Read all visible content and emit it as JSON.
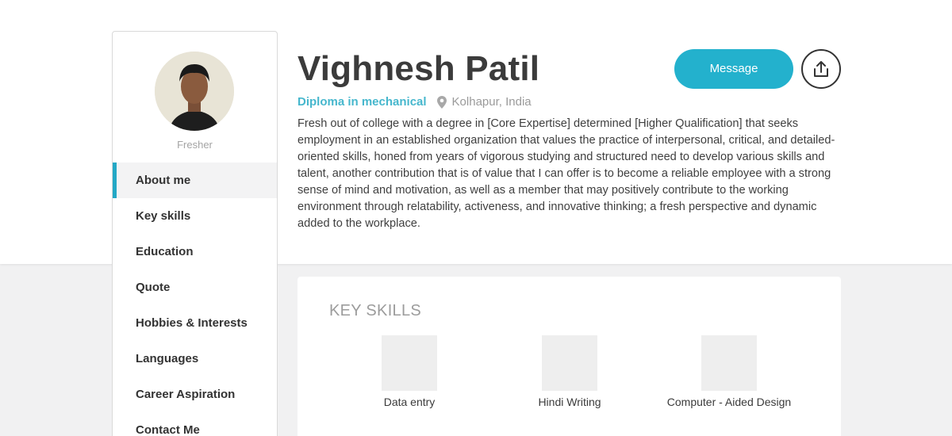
{
  "profile": {
    "name": "Vighnesh Patil",
    "qualification": "Diploma in mechanical",
    "location": "Kolhapur, India",
    "status": "Fresher",
    "bio": "Fresh out of college with a degree in [Core Expertise] determined [Higher Qualification] that seeks employment in an established organization that values the practice of interpersonal, critical, and detailed-oriented skills, honed from years of vigorous studying and structured need to develop various skills and talent, another contribution that is of value that I can offer is to become a reliable employee with a strong sense of mind and motivation, as well as a member that may positively contribute to the working environment through relatability, activeness, and innovative thinking; a fresh perspective and dynamic added to the workplace."
  },
  "actions": {
    "message_label": "Message",
    "share_icon": "share-icon"
  },
  "sidebar": {
    "items": [
      {
        "label": "About me",
        "active": true
      },
      {
        "label": "Key skills"
      },
      {
        "label": "Education"
      },
      {
        "label": "Quote"
      },
      {
        "label": "Hobbies & Interests"
      },
      {
        "label": "Languages"
      },
      {
        "label": "Career Aspiration"
      },
      {
        "label": "Contact Me"
      }
    ]
  },
  "key_skills": {
    "title": "KEY SKILLS",
    "items": [
      {
        "label": "Data entry"
      },
      {
        "label": "Hindi Writing"
      },
      {
        "label": "Computer - Aided Design"
      }
    ]
  },
  "colors": {
    "accent": "#23b1cd",
    "qualification": "#46b7cd",
    "page_bg": "#f1f1f2"
  }
}
